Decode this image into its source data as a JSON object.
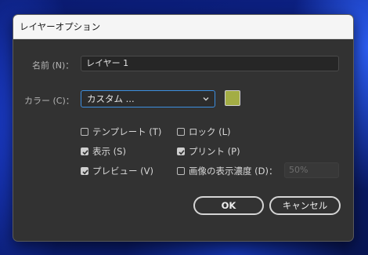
{
  "dialog": {
    "title": "レイヤーオプション",
    "name_label": "名前 (N)：",
    "name_value": "レイヤー 1",
    "color_label": "カラー (C)：",
    "color_selected": "カスタム ...",
    "color_swatch": "#a3ad45",
    "accent_color": "#3d8fe0"
  },
  "options": {
    "template": {
      "label": "テンプレート (T)",
      "checked": false
    },
    "lock": {
      "label": "ロック (L)",
      "checked": false
    },
    "show": {
      "label": "表示 (S)",
      "checked": true
    },
    "print": {
      "label": "プリント (P)",
      "checked": true
    },
    "preview": {
      "label": "プレビュー (V)",
      "checked": true
    },
    "dim": {
      "label": "画像の表示濃度 (D)：",
      "checked": false,
      "value": "50%"
    }
  },
  "buttons": {
    "ok": "OK",
    "cancel": "キャンセル"
  }
}
